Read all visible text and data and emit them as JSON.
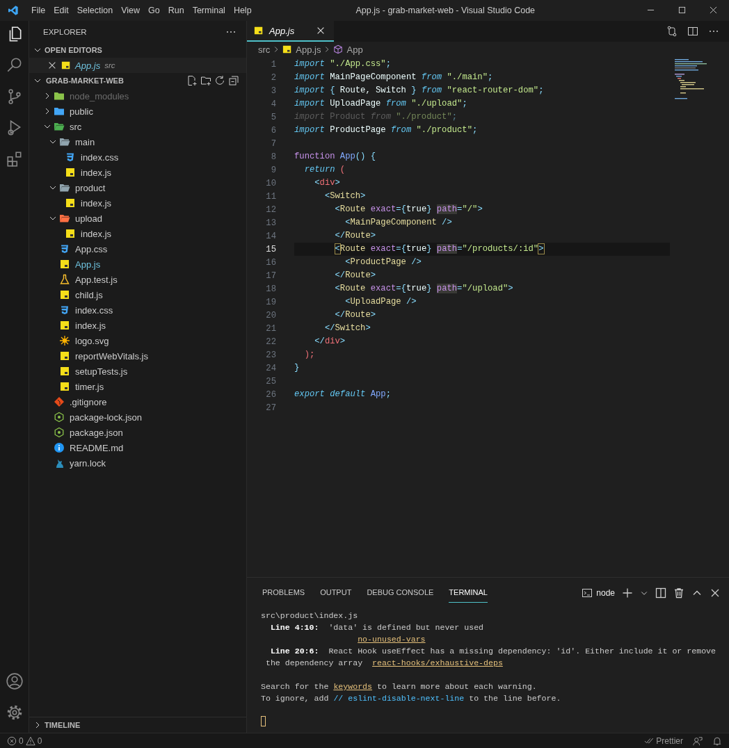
{
  "title_bar": {
    "menu": [
      "File",
      "Edit",
      "Selection",
      "View",
      "Go",
      "Run",
      "Terminal",
      "Help"
    ],
    "title": "App.js - grab-market-web - Visual Studio Code"
  },
  "activity_bar": {
    "top": [
      {
        "kind": "files",
        "selected": true
      },
      {
        "kind": "search",
        "selected": false
      },
      {
        "kind": "source-control",
        "selected": false
      },
      {
        "kind": "run-debug",
        "selected": false
      },
      {
        "kind": "extensions",
        "selected": false
      }
    ],
    "bottom": [
      {
        "kind": "account",
        "selected": false
      },
      {
        "kind": "settings",
        "selected": false
      }
    ]
  },
  "explorer": {
    "title": "EXPLORER",
    "open_editors": {
      "label": "OPEN EDITORS",
      "expanded": true,
      "items": [
        {
          "name": "App.js",
          "folder": "src",
          "kind": "js",
          "selected": true
        }
      ]
    },
    "project": {
      "label": "GRAB-MARKET-WEB",
      "expanded": true,
      "tree": [
        {
          "name": "node_modules",
          "kind": "folder-node",
          "expanded": false,
          "dimmed": true,
          "selected": false
        },
        {
          "name": "public",
          "kind": "folder-public",
          "expanded": false,
          "dimmed": false,
          "selected": false
        },
        {
          "name": "src",
          "kind": "folder-src",
          "expanded": true,
          "dimmed": false,
          "selected": false,
          "children": [
            {
              "name": "main",
              "kind": "folder",
              "expanded": true,
              "dimmed": false,
              "selected": false,
              "children": [
                {
                  "name": "index.css",
                  "kind": "css",
                  "dimmed": false,
                  "selected": false
                },
                {
                  "name": "index.js",
                  "kind": "js",
                  "dimmed": false,
                  "selected": false
                }
              ]
            },
            {
              "name": "product",
              "kind": "folder",
              "expanded": true,
              "dimmed": false,
              "selected": false,
              "children": [
                {
                  "name": "index.js",
                  "kind": "js",
                  "dimmed": false,
                  "selected": false
                }
              ]
            },
            {
              "name": "upload",
              "kind": "folder-upload",
              "expanded": true,
              "dimmed": false,
              "selected": false,
              "children": [
                {
                  "name": "index.js",
                  "kind": "js",
                  "dimmed": false,
                  "selected": false
                }
              ]
            },
            {
              "name": "App.css",
              "kind": "css",
              "dimmed": false,
              "selected": false
            },
            {
              "name": "App.js",
              "kind": "js",
              "dimmed": false,
              "selected": true
            },
            {
              "name": "App.test.js",
              "kind": "test",
              "dimmed": false,
              "selected": false
            },
            {
              "name": "child.js",
              "kind": "js",
              "dimmed": false,
              "selected": false
            },
            {
              "name": "index.css",
              "kind": "css",
              "dimmed": false,
              "selected": false
            },
            {
              "name": "index.js",
              "kind": "js",
              "dimmed": false,
              "selected": false
            },
            {
              "name": "logo.svg",
              "kind": "svg",
              "dimmed": false,
              "selected": false
            },
            {
              "name": "reportWebVitals.js",
              "kind": "js",
              "dimmed": false,
              "selected": false
            },
            {
              "name": "setupTests.js",
              "kind": "js",
              "dimmed": false,
              "selected": false
            },
            {
              "name": "timer.js",
              "kind": "js",
              "dimmed": false,
              "selected": false
            }
          ]
        },
        {
          "name": ".gitignore",
          "kind": "git",
          "dimmed": false,
          "selected": false
        },
        {
          "name": "package-lock.json",
          "kind": "node",
          "dimmed": false,
          "selected": false
        },
        {
          "name": "package.json",
          "kind": "node",
          "dimmed": false,
          "selected": false
        },
        {
          "name": "README.md",
          "kind": "info",
          "dimmed": false,
          "selected": false
        },
        {
          "name": "yarn.lock",
          "kind": "yarn",
          "dimmed": false,
          "selected": false
        }
      ]
    },
    "timeline": {
      "label": "TIMELINE",
      "expanded": false
    }
  },
  "editor": {
    "tabs": [
      {
        "label": "App.js",
        "kind": "js",
        "selected": true
      }
    ],
    "breadcrumb": [
      {
        "text": "src",
        "kind": "folder"
      },
      {
        "text": "App.js",
        "kind": "js"
      },
      {
        "text": "App",
        "kind": "component"
      }
    ],
    "lines": [
      {
        "number": "1",
        "current": false,
        "dimmed": false,
        "tokens": [
          {
            "text": "import ",
            "kind": "kw"
          },
          {
            "text": "\"./App.css\"",
            "kind": "str"
          },
          {
            "text": ";",
            "kind": "punct"
          }
        ]
      },
      {
        "number": "2",
        "current": false,
        "dimmed": false,
        "tokens": [
          {
            "text": "import ",
            "kind": "kw"
          },
          {
            "text": "MainPageComponent ",
            "kind": "text"
          },
          {
            "text": "from ",
            "kind": "kw"
          },
          {
            "text": "\"./main\"",
            "kind": "str"
          },
          {
            "text": ";",
            "kind": "punct"
          }
        ]
      },
      {
        "number": "3",
        "current": false,
        "dimmed": false,
        "tokens": [
          {
            "text": "import ",
            "kind": "kw"
          },
          {
            "text": "{ ",
            "kind": "punct"
          },
          {
            "text": "Route, Switch ",
            "kind": "text"
          },
          {
            "text": "} ",
            "kind": "punct"
          },
          {
            "text": "from ",
            "kind": "kw"
          },
          {
            "text": "\"react-router-dom\"",
            "kind": "str"
          },
          {
            "text": ";",
            "kind": "punct"
          }
        ]
      },
      {
        "number": "4",
        "current": false,
        "dimmed": false,
        "tokens": [
          {
            "text": "import ",
            "kind": "kw"
          },
          {
            "text": "UploadPage ",
            "kind": "text"
          },
          {
            "text": "from ",
            "kind": "kw"
          },
          {
            "text": "\"./upload\"",
            "kind": "str"
          },
          {
            "text": ";",
            "kind": "punct"
          }
        ]
      },
      {
        "number": "5",
        "current": false,
        "dimmed": true,
        "tokens": [
          {
            "text": "import ",
            "kind": "kw"
          },
          {
            "text": "Product ",
            "kind": "text"
          },
          {
            "text": "from ",
            "kind": "kw"
          },
          {
            "text": "\"./product\"",
            "kind": "str"
          },
          {
            "text": ";",
            "kind": "punct"
          }
        ]
      },
      {
        "number": "6",
        "current": false,
        "dimmed": false,
        "tokens": [
          {
            "text": "import ",
            "kind": "kw"
          },
          {
            "text": "ProductPage ",
            "kind": "text"
          },
          {
            "text": "from ",
            "kind": "kw"
          },
          {
            "text": "\"./product\"",
            "kind": "str"
          },
          {
            "text": ";",
            "kind": "punct"
          }
        ]
      },
      {
        "number": "7",
        "current": false
      },
      {
        "number": "8",
        "current": false,
        "dimmed": false,
        "tokens": [
          {
            "text": "function ",
            "kind": "fn"
          },
          {
            "text": "App",
            "kind": "name"
          },
          {
            "text": "() {",
            "kind": "punct"
          }
        ]
      },
      {
        "number": "9",
        "current": false,
        "dimmed": false,
        "tokens": [
          {
            "text": "  return ",
            "kind": "kw"
          },
          {
            "text": "(",
            "kind": "red"
          }
        ]
      },
      {
        "number": "10",
        "current": false,
        "dimmed": false,
        "tokens": [
          {
            "text": "    <",
            "kind": "punct"
          },
          {
            "text": "div",
            "kind": "red"
          },
          {
            "text": ">",
            "kind": "punct"
          }
        ]
      },
      {
        "number": "11",
        "current": false,
        "dimmed": false,
        "tokens": [
          {
            "text": "      <",
            "kind": "punct"
          },
          {
            "text": "Switch",
            "kind": "tag"
          },
          {
            "text": ">",
            "kind": "punct"
          }
        ]
      },
      {
        "number": "12",
        "current": false,
        "dimmed": false,
        "tokens": [
          {
            "text": "        <",
            "kind": "punct"
          },
          {
            "text": "Route",
            "kind": "tag"
          },
          {
            "text": " exact",
            "kind": "attr"
          },
          {
            "text": "={",
            "kind": "punct"
          },
          {
            "text": "true",
            "kind": "text"
          },
          {
            "text": "} ",
            "kind": "punct"
          },
          {
            "text": "path",
            "kind": "attrhl"
          },
          {
            "text": "=",
            "kind": "punct"
          },
          {
            "text": "\"/\"",
            "kind": "str"
          },
          {
            "text": ">",
            "kind": "punct"
          }
        ]
      },
      {
        "number": "13",
        "current": false,
        "dimmed": false,
        "tokens": [
          {
            "text": "          <",
            "kind": "punct"
          },
          {
            "text": "MainPageComponent",
            "kind": "tag"
          },
          {
            "text": " />",
            "kind": "punct"
          }
        ]
      },
      {
        "number": "14",
        "current": false,
        "dimmed": false,
        "tokens": [
          {
            "text": "        </",
            "kind": "punct"
          },
          {
            "text": "Route",
            "kind": "tag"
          },
          {
            "text": ">",
            "kind": "punct"
          }
        ]
      },
      {
        "number": "15",
        "current": true,
        "dimmed": false,
        "tokens": [
          {
            "text": "        <",
            "kind": "match"
          },
          {
            "text": "Route",
            "kind": "tag"
          },
          {
            "text": " exact",
            "kind": "attr"
          },
          {
            "text": "={",
            "kind": "punct"
          },
          {
            "text": "true",
            "kind": "text"
          },
          {
            "text": "} ",
            "kind": "punct"
          },
          {
            "text": "path",
            "kind": "attrhl"
          },
          {
            "text": "=",
            "kind": "punct"
          },
          {
            "text": "\"/products/:id\"",
            "kind": "str"
          },
          {
            "text": ">",
            "kind": "match"
          }
        ]
      },
      {
        "number": "16",
        "current": false,
        "dimmed": false,
        "tokens": [
          {
            "text": "          <",
            "kind": "punct"
          },
          {
            "text": "ProductPage",
            "kind": "tag"
          },
          {
            "text": " />",
            "kind": "punct"
          }
        ]
      },
      {
        "number": "17",
        "current": false,
        "dimmed": false,
        "tokens": [
          {
            "text": "        </",
            "kind": "punct"
          },
          {
            "text": "Route",
            "kind": "tag"
          },
          {
            "text": ">",
            "kind": "punct"
          }
        ]
      },
      {
        "number": "18",
        "current": false,
        "dimmed": false,
        "tokens": [
          {
            "text": "        <",
            "kind": "punct"
          },
          {
            "text": "Route",
            "kind": "tag"
          },
          {
            "text": " exact",
            "kind": "attr"
          },
          {
            "text": "={",
            "kind": "punct"
          },
          {
            "text": "true",
            "kind": "text"
          },
          {
            "text": "} ",
            "kind": "punct"
          },
          {
            "text": "path",
            "kind": "attrhl"
          },
          {
            "text": "=",
            "kind": "punct"
          },
          {
            "text": "\"/upload\"",
            "kind": "str"
          },
          {
            "text": ">",
            "kind": "punct"
          }
        ]
      },
      {
        "number": "19",
        "current": false,
        "dimmed": false,
        "tokens": [
          {
            "text": "          <",
            "kind": "punct"
          },
          {
            "text": "UploadPage",
            "kind": "tag"
          },
          {
            "text": " />",
            "kind": "punct"
          }
        ]
      },
      {
        "number": "20",
        "current": false,
        "dimmed": false,
        "tokens": [
          {
            "text": "        </",
            "kind": "punct"
          },
          {
            "text": "Route",
            "kind": "tag"
          },
          {
            "text": ">",
            "kind": "punct"
          }
        ]
      },
      {
        "number": "21",
        "current": false,
        "dimmed": false,
        "tokens": [
          {
            "text": "      </",
            "kind": "punct"
          },
          {
            "text": "Switch",
            "kind": "tag"
          },
          {
            "text": ">",
            "kind": "punct"
          }
        ]
      },
      {
        "number": "22",
        "current": false,
        "dimmed": false,
        "tokens": [
          {
            "text": "    </",
            "kind": "punct"
          },
          {
            "text": "div",
            "kind": "red"
          },
          {
            "text": ">",
            "kind": "punct"
          }
        ]
      },
      {
        "number": "23",
        "current": false,
        "dimmed": false,
        "tokens": [
          {
            "text": "  );",
            "kind": "red"
          }
        ]
      },
      {
        "number": "24",
        "current": false,
        "dimmed": false,
        "tokens": [
          {
            "text": "}",
            "kind": "punct"
          }
        ]
      },
      {
        "number": "25",
        "current": false
      },
      {
        "number": "26",
        "current": false,
        "dimmed": false,
        "tokens": [
          {
            "text": "export default ",
            "kind": "kw"
          },
          {
            "text": "App",
            "kind": "name"
          },
          {
            "text": ";",
            "kind": "punct"
          }
        ]
      },
      {
        "number": "27",
        "current": false
      }
    ]
  },
  "panel": {
    "tabs": [
      {
        "label": "PROBLEMS",
        "selected": false
      },
      {
        "label": "OUTPUT",
        "selected": false
      },
      {
        "label": "DEBUG CONSOLE",
        "selected": false
      },
      {
        "label": "TERMINAL",
        "selected": true
      }
    ],
    "terminal_name": "node",
    "blocks": [
      [
        [
          {
            "text": "src\\product\\index.js",
            "kind": "text"
          }
        ],
        [
          {
            "text": "  Line 4:10:",
            "kind": "bold"
          },
          {
            "text": "  'data' is defined but never used",
            "kind": "text"
          }
        ],
        [
          {
            "text": "                    no-unused-vars",
            "kind": "link"
          }
        ],
        [
          {
            "text": "  Line 20:6:",
            "kind": "bold"
          },
          {
            "text": "  React Hook useEffect has a missing dependency: 'id'. Either include it or remove",
            "kind": "text"
          }
        ],
        [
          {
            "text": " the dependency array  ",
            "kind": "text"
          },
          {
            "text": "react-hooks/exhaustive-deps",
            "kind": "link"
          }
        ]
      ],
      [
        [
          {
            "text": "Search for the ",
            "kind": "text"
          },
          {
            "text": "keywords",
            "kind": "link"
          },
          {
            "text": " to learn more about each warning.",
            "kind": "text"
          }
        ],
        [
          {
            "text": "To ignore, add ",
            "kind": "text"
          },
          {
            "text": "// eslint-disable-next-line",
            "kind": "comment"
          },
          {
            "text": " to the line before.",
            "kind": "text"
          }
        ]
      ]
    ]
  },
  "status_bar": {
    "errors": "0",
    "warnings": "0",
    "formatter": "Prettier"
  }
}
